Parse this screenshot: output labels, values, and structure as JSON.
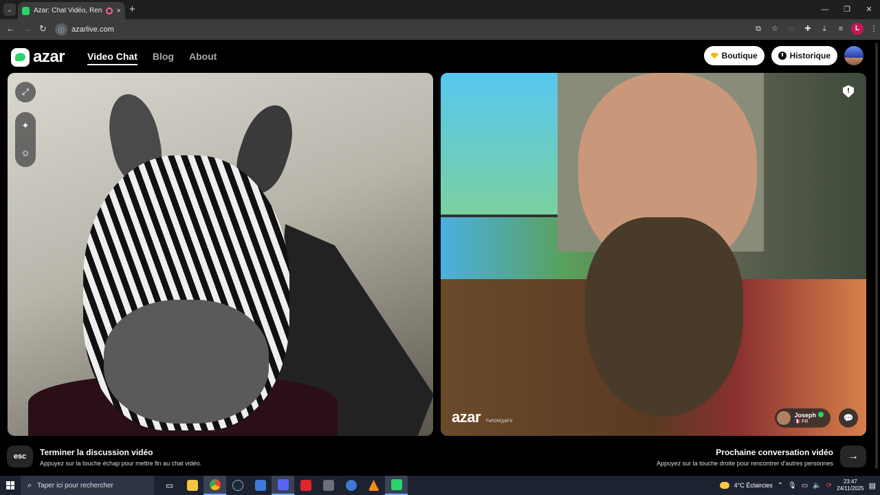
{
  "browser": {
    "tab_title": "Azar: Chat Vidéo, Rencontres",
    "tab_close": "×",
    "new_tab": "+",
    "url": "azarlive.com",
    "tab_list_icon": "⌄",
    "window_controls": [
      "—",
      "❐",
      "✕"
    ],
    "profile_initial": "L",
    "toolbar_icons": [
      "screen-cast-icon",
      "star-icon",
      "extension-icon",
      "puzzle-icon",
      "download-icon",
      "media-icon",
      "profile-icon",
      "menu-icon"
    ]
  },
  "site": {
    "logo_text": "azar",
    "nav": [
      {
        "label": "Video Chat",
        "active": true
      },
      {
        "label": "Blog",
        "active": false
      },
      {
        "label": "About",
        "active": false
      }
    ],
    "shop_label": "Boutique",
    "history_label": "Historique"
  },
  "remote": {
    "watermark_logo": "azar",
    "watermark_id": "FeRDNQpkFd",
    "partner_name": "Joseph",
    "partner_country": "🇫🇷 FR"
  },
  "bottom": {
    "esc_label": "esc",
    "end_title": "Terminer la discussion vidéo",
    "end_sub": "Appuyez sur la touche échap pour mettre fin au chat vidéo.",
    "next_title": "Prochaine conversation vidéo",
    "next_sub": "Appuyez sur la touche droite pour rencontrer d'autres personnes",
    "next_arrow": "→"
  },
  "taskbar": {
    "search_placeholder": "Taper ici pour rechercher",
    "weather": "4°C  Éclaircies",
    "time": "23:47",
    "date": "24/11/2025",
    "apps": [
      "task-view-icon",
      "file-explorer-icon",
      "chrome-icon",
      "steam-icon",
      "app-icon",
      "discord-icon",
      "wps-icon",
      "antivirus-icon",
      "qbittorrent-icon",
      "vlc-icon",
      "android-icon"
    ]
  },
  "colors": {
    "brand_green": "#2bd46a",
    "background": "#000000"
  }
}
